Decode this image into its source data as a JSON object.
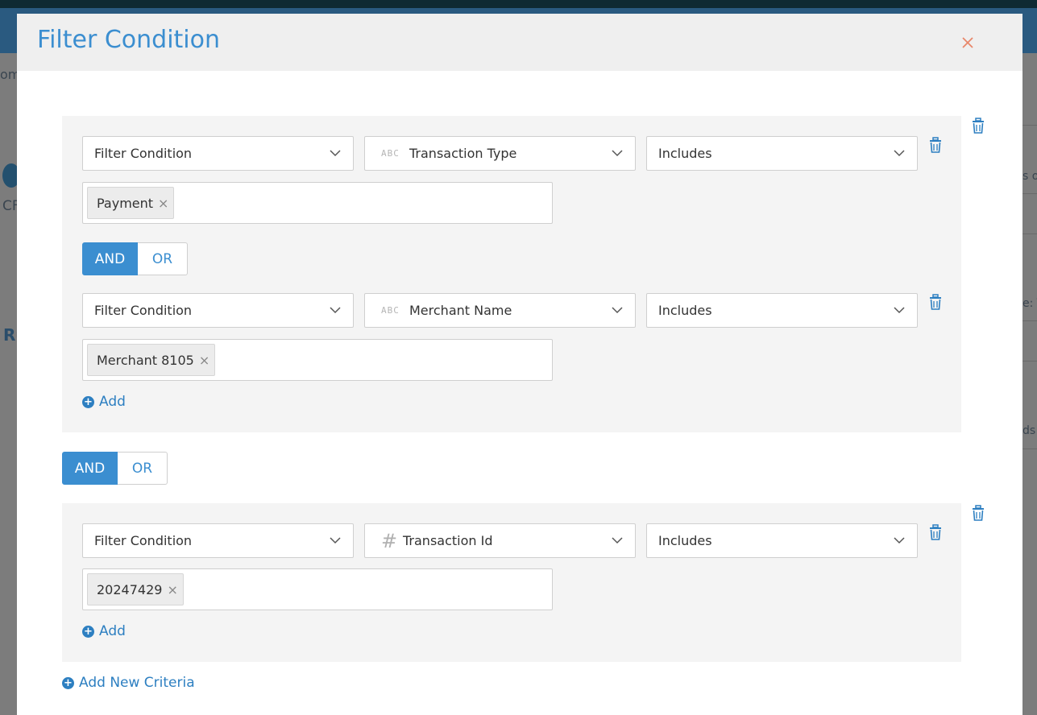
{
  "background": {
    "fragments": [
      "om",
      "CF",
      "Ru",
      "s o",
      "e: T",
      "ds"
    ]
  },
  "modal": {
    "title": "Filter Condition",
    "close_label": "×"
  },
  "groups": [
    {
      "rows": [
        {
          "condition": "Filter Condition",
          "field_type_icon": "ABC",
          "field": "Transaction Type",
          "operator": "Includes",
          "tags": [
            "Payment"
          ]
        },
        {
          "condition": "Filter Condition",
          "field_type_icon": "ABC",
          "field": "Merchant Name",
          "operator": "Includes",
          "tags": [
            "Merchant 8105"
          ]
        }
      ],
      "joiner": {
        "and": "AND",
        "or": "OR",
        "selected": "AND"
      },
      "add_label": "Add"
    },
    {
      "rows": [
        {
          "condition": "Filter Condition",
          "field_type_icon": "#",
          "field": "Transaction Id",
          "operator": "Includes",
          "tags": [
            "20247429"
          ]
        }
      ],
      "add_label": "Add"
    }
  ],
  "group_joiner": {
    "and": "AND",
    "or": "OR",
    "selected": "AND"
  },
  "add_new_criteria_label": "Add New Criteria",
  "colors": {
    "accent": "#3b8ed0",
    "link": "#2d7fc1",
    "close": "#e8866a",
    "panel": "#f4f4f4"
  },
  "icons": {
    "close": "close-icon",
    "chevron": "chevron-down-icon",
    "trash": "trash-icon",
    "plus": "plus-circle-icon",
    "tag_remove": "tag-remove-icon"
  }
}
